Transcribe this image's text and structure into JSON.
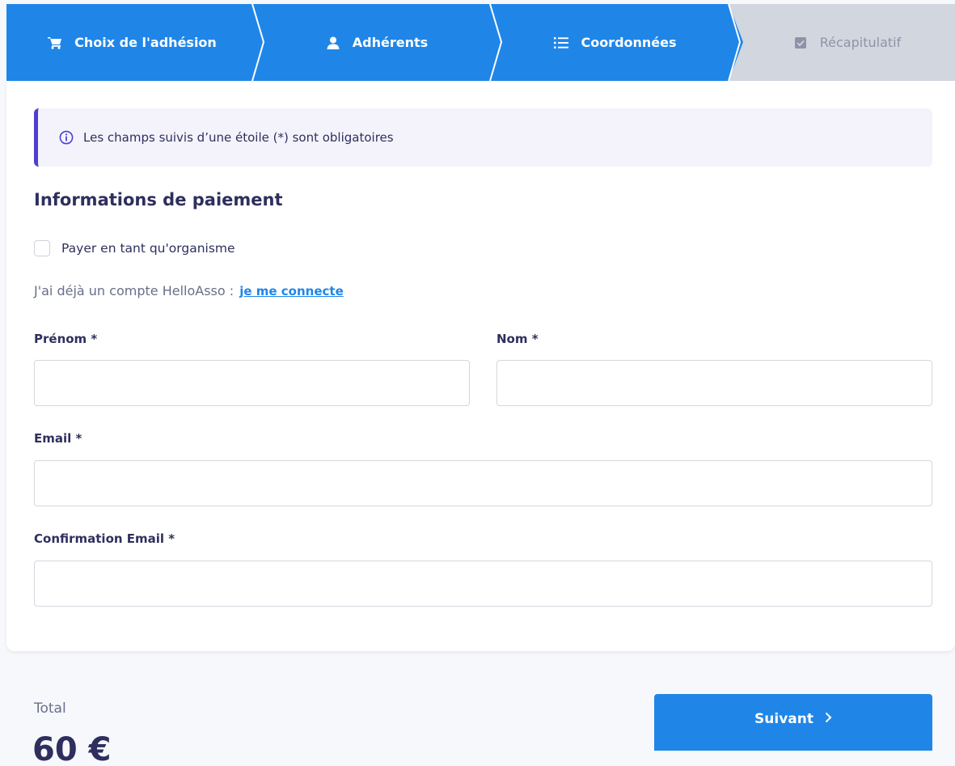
{
  "stepper": {
    "steps": [
      {
        "label": "Choix de l'adhésion",
        "icon": "cart-icon",
        "state": "completed"
      },
      {
        "label": "Adhérents",
        "icon": "user-icon",
        "state": "completed"
      },
      {
        "label": "Coordonnées",
        "icon": "list-icon",
        "state": "current"
      },
      {
        "label": "Récapitulatif",
        "icon": "checkbox-icon",
        "state": "upcoming"
      }
    ],
    "colors": {
      "active": "#1f86e8",
      "inactive": "#d2d6df"
    }
  },
  "info": {
    "text": "Les champs suivis d’une étoile (*) sont obligatoires",
    "icon": "info-icon",
    "accent": "#4c40cf"
  },
  "form": {
    "title": "Informations de paiement",
    "organism_checkbox": {
      "label": "Payer en tant qu'organisme",
      "checked": false
    },
    "account": {
      "text": "J'ai déjà un compte HelloAsso :",
      "link": "je me connecte"
    },
    "fields": {
      "first_name": {
        "label": "Prénom *",
        "value": ""
      },
      "last_name": {
        "label": "Nom *",
        "value": ""
      },
      "email": {
        "label": "Email *",
        "value": ""
      },
      "email_confirm": {
        "label": "Confirmation Email *",
        "value": ""
      }
    }
  },
  "footer": {
    "total_label": "Total",
    "total_value": "60 €",
    "next_button": "Suivant",
    "next_icon": "chevron-right-icon"
  }
}
